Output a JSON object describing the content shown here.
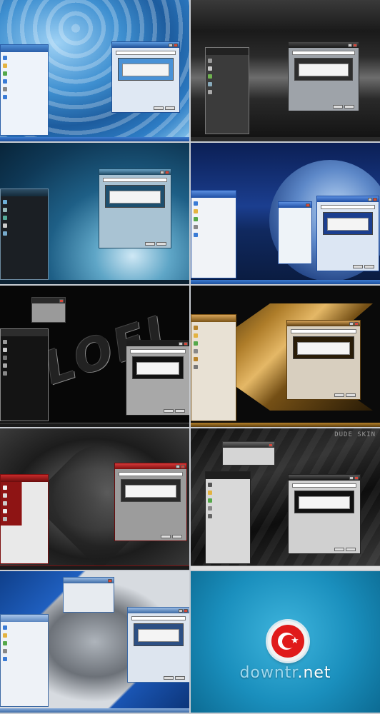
{
  "brand": {
    "text_light": "downtr",
    "text_bold": ".net"
  },
  "watermark": {
    "text": "DUDE SKIN"
  },
  "themes": [
    {
      "name": "theme-blue-water",
      "accent": "#3e8fd0"
    },
    {
      "name": "theme-dark-wave",
      "accent": "#6d6d6d"
    },
    {
      "name": "theme-teal-glass",
      "accent": "#1e5f86"
    },
    {
      "name": "theme-blue-moon",
      "accent": "#1b3e8f"
    },
    {
      "name": "theme-lofi-black",
      "accent": "#222222"
    },
    {
      "name": "theme-gold-x",
      "accent": "#b7832b"
    },
    {
      "name": "theme-red-heart",
      "accent": "#b01919"
    },
    {
      "name": "theme-dark-keyboard",
      "accent": "#2e2e2e"
    },
    {
      "name": "theme-blue-x",
      "accent": "#1f5fbf"
    }
  ],
  "flag_colors": {
    "red": "#e01a1a",
    "white": "#ffffff"
  }
}
